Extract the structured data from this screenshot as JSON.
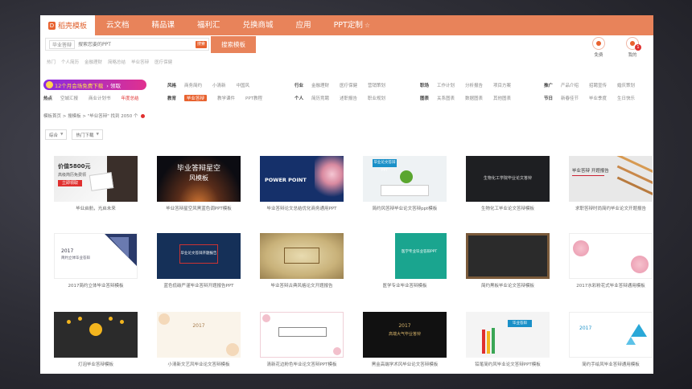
{
  "nav": {
    "brand": "稻壳模板",
    "items": [
      "云文档",
      "精品课",
      "福利汇",
      "兑换商城",
      "应用",
      "PPT定制"
    ]
  },
  "search": {
    "chip": "毕业答辩",
    "placeholder": "搜索您要的PPT",
    "go": "搜索",
    "button": "搜索模板",
    "hot_words": [
      "热门",
      "个人简历",
      "金融理财",
      "简略总结",
      "毕业答辩",
      "医疗保健"
    ]
  },
  "right": {
    "icons": [
      {
        "label": "免费"
      },
      {
        "label": "我的",
        "badge": "1"
      }
    ]
  },
  "promo": {
    "text": "12个月会场免费下载",
    "claim": "› 领取"
  },
  "filters": {
    "row1": [
      {
        "label": "风格",
        "items": [
          "商务简约",
          "小清新",
          "中国风"
        ]
      },
      {
        "label": "行业",
        "items": [
          "金融理财",
          "医疗保健",
          "营销策划"
        ]
      },
      {
        "label": "职场",
        "items": [
          "工作计划",
          "分析报告",
          "项目方案"
        ]
      },
      {
        "label": "推广",
        "items": [
          "产品介绍",
          "招聘宣传",
          "婚庆策划"
        ]
      }
    ],
    "row2_lead": [
      "热点",
      "空城汇报",
      "商业计划书",
      "年度总结"
    ],
    "row2": [
      {
        "label": "教育",
        "items": [
          "毕业答辩",
          "教学课件",
          "PPT教程"
        ]
      },
      {
        "label": "个人",
        "items": [
          "简历竞聘",
          "述职报告",
          "职业规划"
        ]
      },
      {
        "label": "图表",
        "items": [
          "关系图表",
          "数据图表",
          "其他图表"
        ]
      },
      {
        "label": "节日",
        "items": [
          "新春佳节",
          "毕业季度",
          "生日快乐"
        ]
      }
    ]
  },
  "crumb": {
    "text": "模板首页 > 搜模板 > \"毕业答辩\" 找到 2050 个"
  },
  "sort": {
    "left": "综合",
    "right": "热门下载"
  },
  "cards": [
    {
      "caption": "毕业启航，光启未来"
    },
    {
      "caption": "毕业答辩星空风黑蓝色调PPT模板"
    },
    {
      "caption": "毕业答辩论文总结优化商务通用PPT"
    },
    {
      "caption": "简约风答辩毕业论文答辩ppt模板"
    },
    {
      "caption": "生物化工毕业论文答辩模板"
    },
    {
      "caption": "求职答辩时尚简约毕业论文开题报告"
    },
    {
      "caption": "2017简约立体毕业答辩模板"
    },
    {
      "caption": "蓝色低碳严谨毕业答辩开题报告PPT"
    },
    {
      "caption": "毕业答辩古典风格论文开题报告"
    },
    {
      "caption": "医学专业毕业答辩模板"
    },
    {
      "caption": "简约黑板毕业论文答辩模板"
    },
    {
      "caption": "2017水彩粉花式毕业答辩通用模板"
    },
    {
      "caption": "灯泡毕业答辩模板"
    },
    {
      "caption": "小清新文艺风毕业论文答辩模板"
    },
    {
      "caption": "清新花边粉色毕业论文答辩PPT模板"
    },
    {
      "caption": "黑金高端学术风毕业论文答辩模板"
    },
    {
      "caption": "铅笔简约风毕业论文答辩PPT模板"
    },
    {
      "caption": "简约手绘风毕业答辩通用模板"
    }
  ],
  "thumb_text": {
    "t1_a": "价值5800元",
    "t1_b": "高级简历免费领",
    "t1_c": "立即领取",
    "t2_a": "毕业答辩星空",
    "t2_b": "风模板",
    "t3": "POWER POINT",
    "t4": "毕业论文答辩PPT",
    "t5": "生物化工学院毕业论文答辩",
    "t6": "毕业答辩 开题报告",
    "t7_a": "2017",
    "t7_b": "简约立体毕业答辩",
    "t8": "毕业论文答辩开题报告",
    "t10": "医学专业毕业答辩PPT",
    "t13_a": "2017",
    "t14_a": "2017",
    "t16_a": "2017",
    "t16_b": "高端大气毕业答辩",
    "t17": "毕业答辩"
  }
}
